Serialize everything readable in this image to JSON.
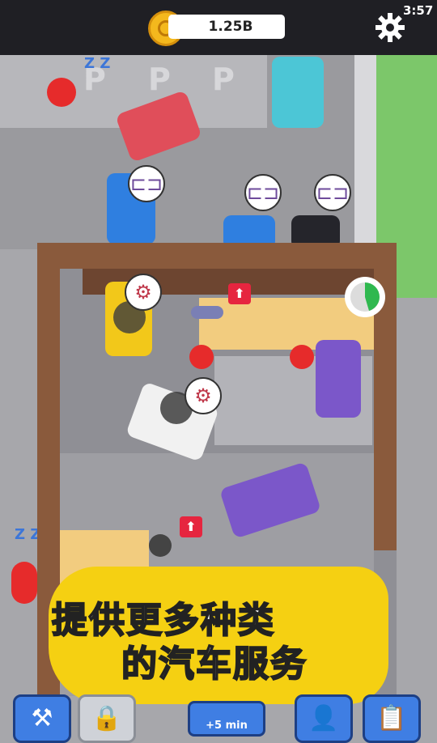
{
  "status": {
    "time": "3:57"
  },
  "hud": {
    "balance": "1.25B",
    "coin_icon": "coin-icon",
    "settings_icon": "gear-icon"
  },
  "parking": {
    "marks": [
      "P",
      "P",
      "P"
    ]
  },
  "requests": [
    {
      "icon": "exhaust-pipe-icon"
    },
    {
      "icon": "exhaust-pipe-icon"
    },
    {
      "icon": "exhaust-pipe-icon"
    },
    {
      "icon": "engine-icon"
    },
    {
      "icon": "engine-icon"
    }
  ],
  "sleep_marks": [
    "Z Z",
    "Z Z"
  ],
  "upgrade_arrow": "⬆",
  "banner": {
    "line1": "提供更多种类",
    "line2": "的汽车服务"
  },
  "toolbar": {
    "timer_label": "+5 min",
    "buttons": [
      "hammer-icon",
      "lock-icon",
      "video-icon",
      "worker-icon",
      "clipboard-icon"
    ]
  },
  "colors": {
    "accent": "#3f7ee3",
    "coin": "#f4b81d",
    "banner": "#f5d012",
    "grass": "#7cc76a"
  }
}
